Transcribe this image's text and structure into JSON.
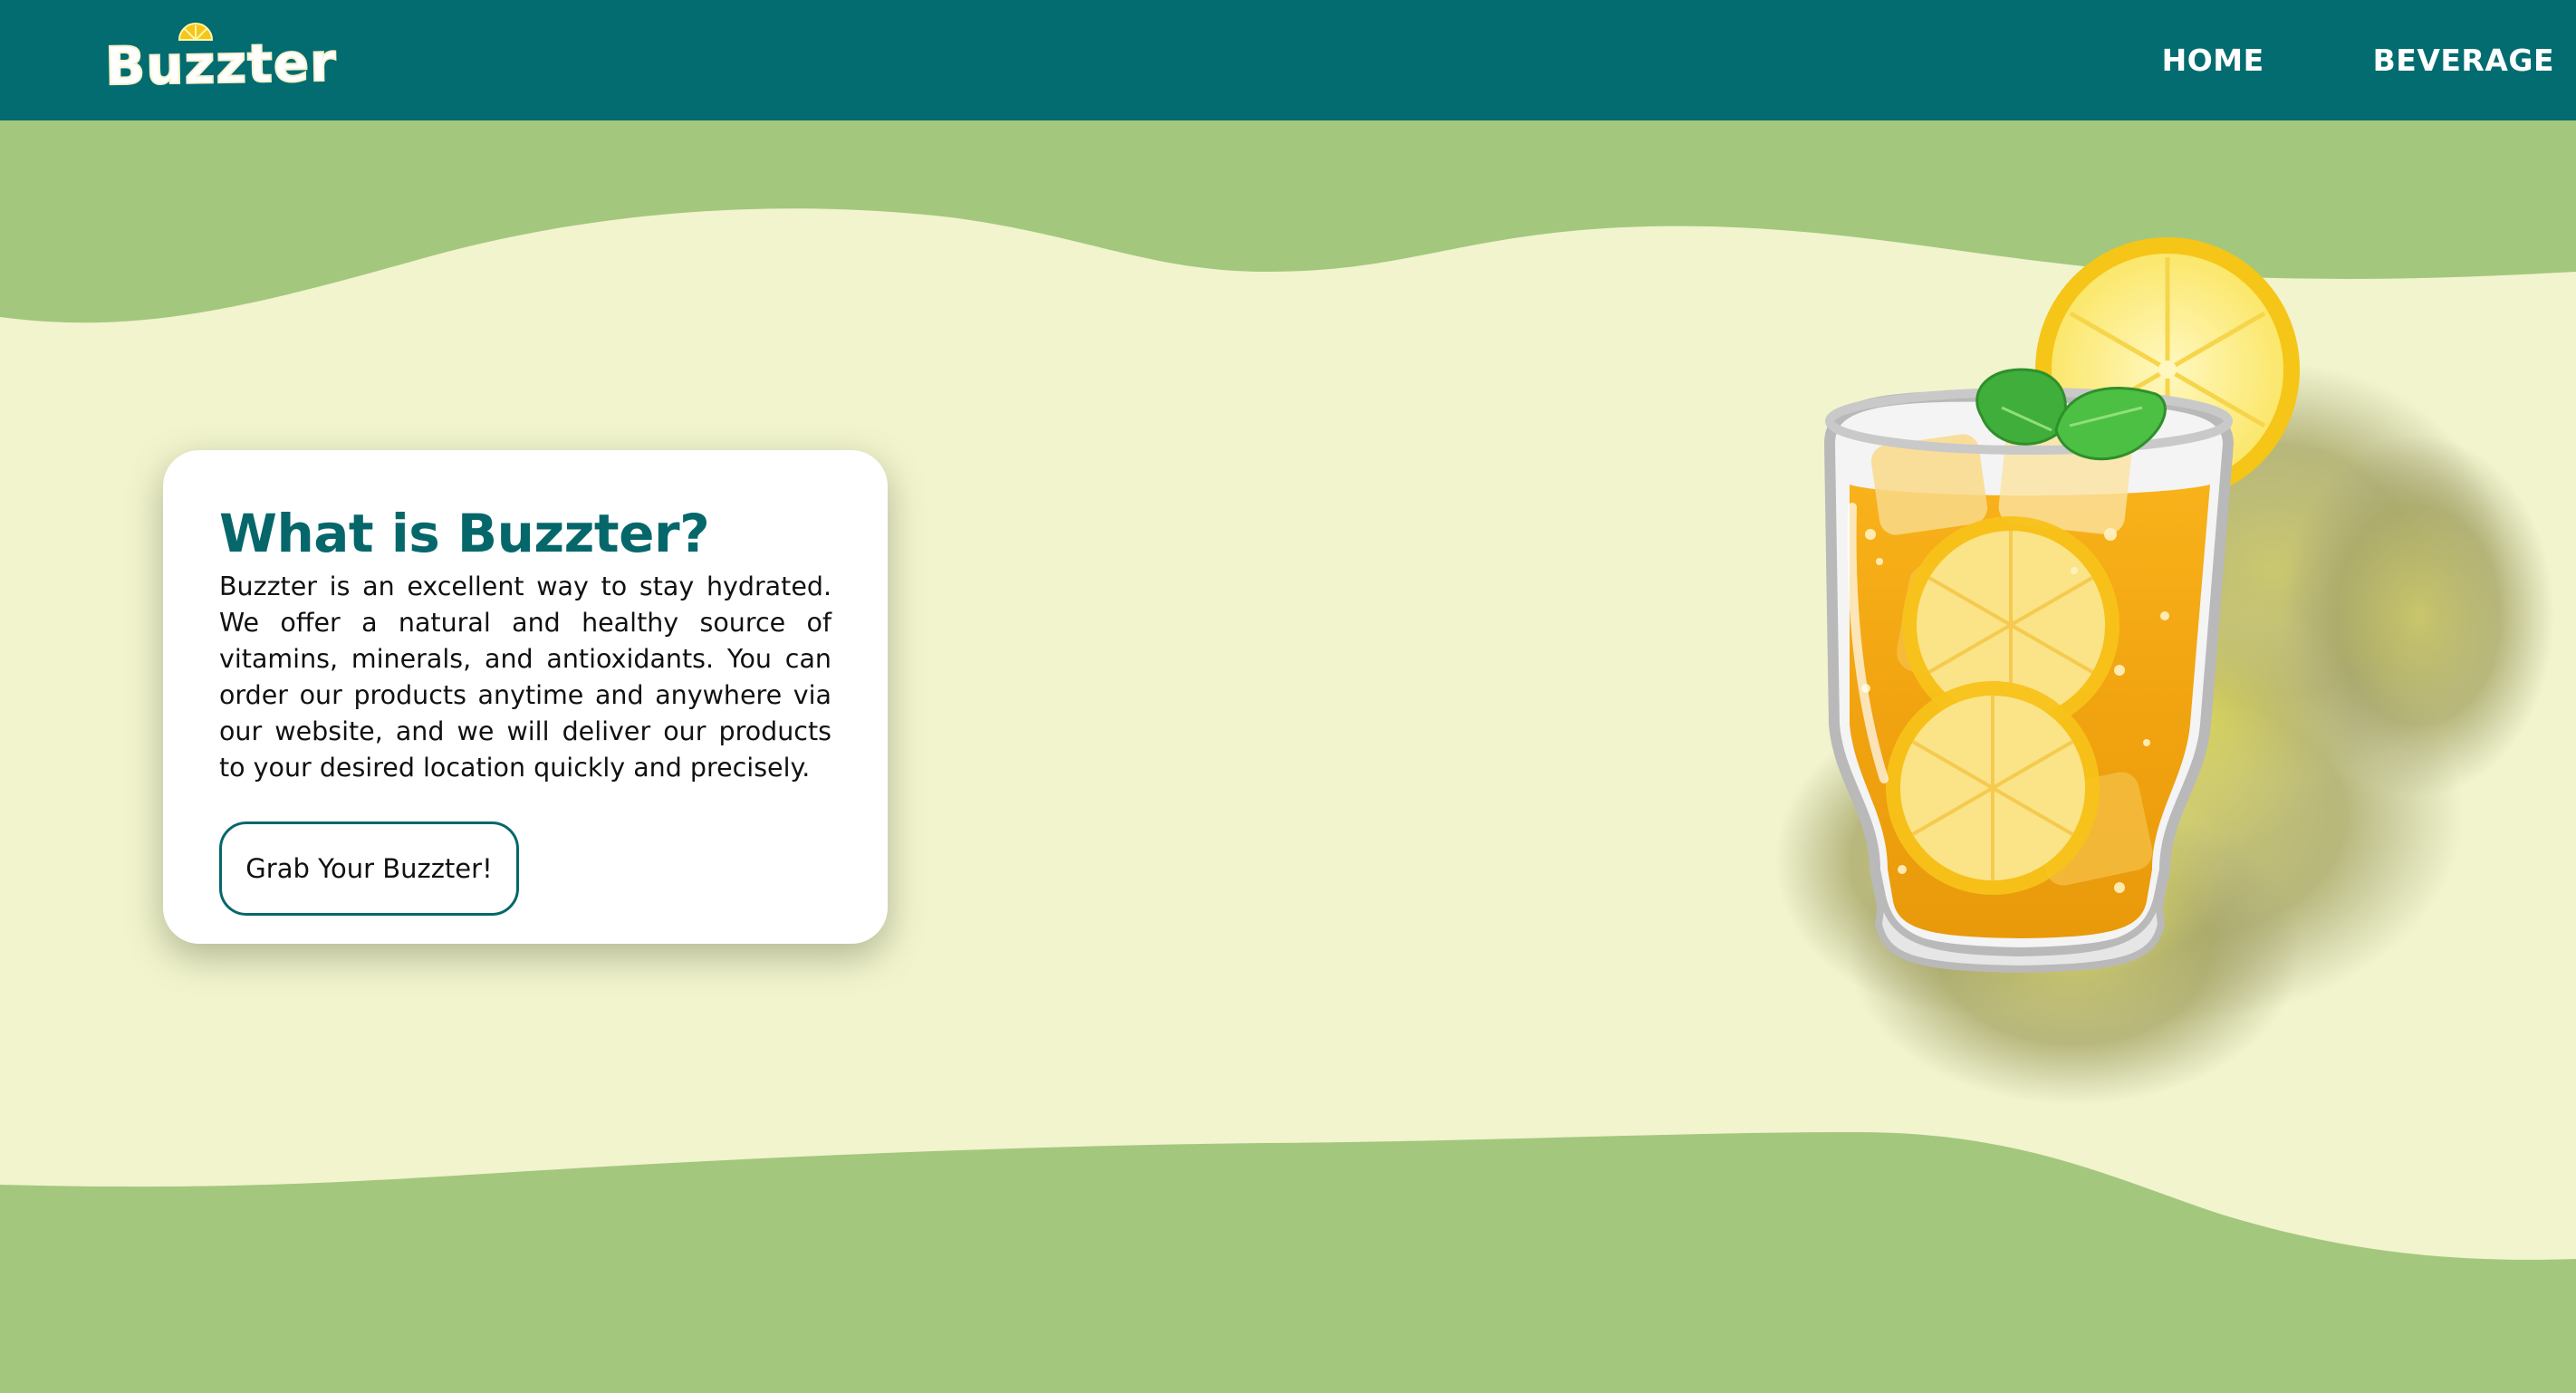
{
  "header": {
    "logo_text": "Buzzter",
    "nav": [
      {
        "label": "HOME"
      },
      {
        "label": "BEVERAGE"
      }
    ]
  },
  "card": {
    "title": "What is Buzzter?",
    "body": "Buzzter is an excellent way to stay hydrated. We offer a natural and healthy source of vitamins, minerals, and antioxidants. You can order our products anytime and anywhere via our website, and we will deliver our products to your desired location quickly and precisely.",
    "cta_label": "Grab Your Buzzter!"
  },
  "colors": {
    "header_bg": "#026c70",
    "wave_green": "#a4c77e",
    "cream": "#f1f4cd",
    "title_teal": "#06676b",
    "lemon_yellow": "#f5c518"
  },
  "icons": {
    "logo_lemon": "lemon-slice-icon",
    "hero_image": "iced-lemon-tea-glass"
  }
}
